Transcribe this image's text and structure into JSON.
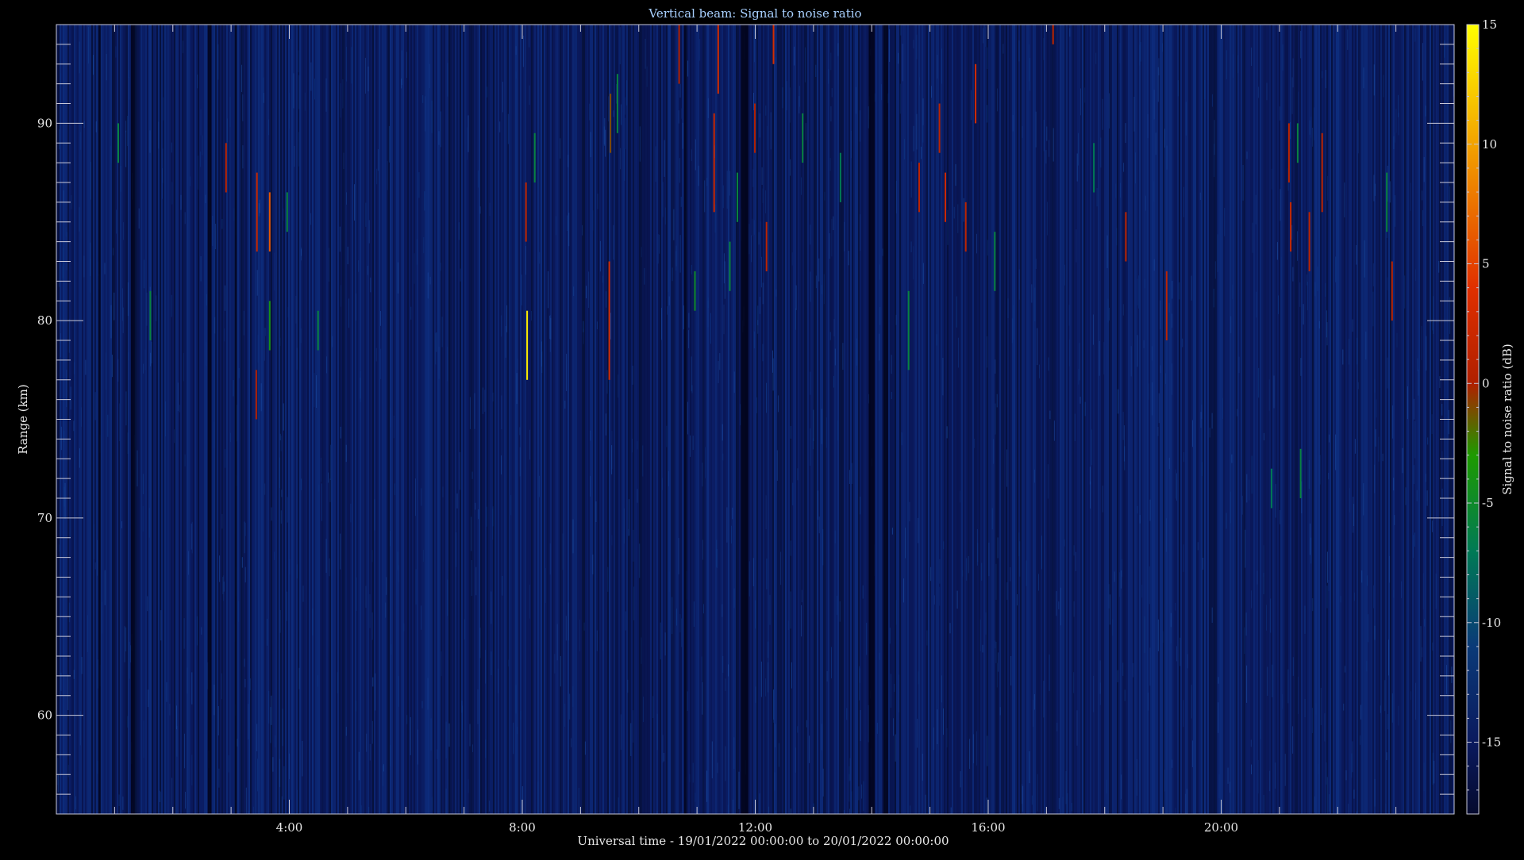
{
  "chart_data": {
    "type": "heatmap",
    "title": "Vertical beam: Signal to noise ratio",
    "xlabel": "Universal time - 19/01/2022 00:00:00 to 20/01/2022 00:00:00",
    "ylabel": "Range (km)",
    "x_unit": "hours UT",
    "xlim": [
      0,
      24
    ],
    "ylim": [
      55,
      95
    ],
    "x_ticks": [
      {
        "value": 4,
        "label": "4:00"
      },
      {
        "value": 8,
        "label": "8:00"
      },
      {
        "value": 12,
        "label": "12:00"
      },
      {
        "value": 16,
        "label": "16:00"
      },
      {
        "value": 20,
        "label": "20:00"
      }
    ],
    "x_minor_step": 1,
    "y_ticks": [
      {
        "value": 60,
        "label": "60"
      },
      {
        "value": 70,
        "label": "70"
      },
      {
        "value": 80,
        "label": "80"
      },
      {
        "value": 90,
        "label": "90"
      }
    ],
    "y_minor_step": 1,
    "colorbar": {
      "label": "Signal to noise ratio (dB)",
      "range": [
        -18,
        15
      ],
      "ticks": [
        {
          "value": 15,
          "label": "15"
        },
        {
          "value": 10,
          "label": "10"
        },
        {
          "value": 5,
          "label": "5"
        },
        {
          "value": 0,
          "label": "0"
        },
        {
          "value": -5,
          "label": "-5"
        },
        {
          "value": -10,
          "label": "-10"
        },
        {
          "value": -15,
          "label": "-15"
        }
      ],
      "minor_step": 1,
      "colormap": [
        {
          "value": -18,
          "color": "#050a2e"
        },
        {
          "value": -15,
          "color": "#0a1a5e"
        },
        {
          "value": -11,
          "color": "#0a3a78"
        },
        {
          "value": -7,
          "color": "#007a55"
        },
        {
          "value": -3,
          "color": "#1e9a00"
        },
        {
          "value": 0,
          "color": "#b02000"
        },
        {
          "value": 4,
          "color": "#e03000"
        },
        {
          "value": 9,
          "color": "#f09000"
        },
        {
          "value": 15,
          "color": "#ffff00"
        }
      ]
    },
    "background_level_db": -15,
    "data_gaps_hours": [
      [
        1.28,
        1.36
      ],
      [
        2.6,
        2.66
      ],
      [
        3.06,
        3.1
      ],
      [
        11.75,
        11.88
      ],
      [
        10.78,
        10.82
      ],
      [
        13.95,
        14.05
      ],
      [
        14.2,
        14.28
      ],
      [
        0.72,
        0.76
      ]
    ],
    "echoes": [
      {
        "time": 2.9,
        "range_top": 89.0,
        "range_bottom": 86.5,
        "snr": 1
      },
      {
        "time": 3.43,
        "range_top": 87.5,
        "range_bottom": 83.5,
        "snr": 2
      },
      {
        "time": 3.42,
        "range_top": 77.5,
        "range_bottom": 75.0,
        "snr": 0
      },
      {
        "time": 3.65,
        "range_top": 86.5,
        "range_bottom": 83.5,
        "snr": 6
      },
      {
        "time": 3.65,
        "range_top": 81.0,
        "range_bottom": 78.5,
        "snr": -4
      },
      {
        "time": 3.95,
        "range_top": 86.5,
        "range_bottom": 84.5,
        "snr": -6
      },
      {
        "time": 4.48,
        "range_top": 80.5,
        "range_bottom": 78.5,
        "snr": -6
      },
      {
        "time": 1.6,
        "range_top": 81.5,
        "range_bottom": 79.0,
        "snr": -6
      },
      {
        "time": 1.05,
        "range_top": 90.0,
        "range_bottom": 88.0,
        "snr": -6
      },
      {
        "time": 8.05,
        "range_top": 87.0,
        "range_bottom": 84.0,
        "snr": 1
      },
      {
        "time": 8.07,
        "range_top": 80.5,
        "range_bottom": 77.0,
        "snr": 14
      },
      {
        "time": 9.48,
        "range_top": 83.0,
        "range_bottom": 77.0,
        "snr": 3
      },
      {
        "time": 9.5,
        "range_top": 91.5,
        "range_bottom": 88.5,
        "snr": -1
      },
      {
        "time": 9.62,
        "range_top": 92.5,
        "range_bottom": 89.5,
        "snr": -6
      },
      {
        "time": 8.2,
        "range_top": 89.5,
        "range_bottom": 87.0,
        "snr": -6
      },
      {
        "time": 10.68,
        "range_top": 95.0,
        "range_bottom": 92.0,
        "snr": 0
      },
      {
        "time": 11.28,
        "range_top": 90.5,
        "range_bottom": 85.5,
        "snr": 2
      },
      {
        "time": 11.35,
        "range_top": 95.0,
        "range_bottom": 91.5,
        "snr": 3
      },
      {
        "time": 11.55,
        "range_top": 84.0,
        "range_bottom": 81.5,
        "snr": -6
      },
      {
        "time": 11.68,
        "range_top": 87.5,
        "range_bottom": 85.0,
        "snr": -6
      },
      {
        "time": 11.98,
        "range_top": 91.0,
        "range_bottom": 88.5,
        "snr": 0
      },
      {
        "time": 12.3,
        "range_top": 95.0,
        "range_bottom": 93.0,
        "snr": 3
      },
      {
        "time": 12.18,
        "range_top": 85.0,
        "range_bottom": 82.5,
        "snr": 1
      },
      {
        "time": 12.8,
        "range_top": 90.5,
        "range_bottom": 88.0,
        "snr": -6
      },
      {
        "time": 10.95,
        "range_top": 82.5,
        "range_bottom": 80.5,
        "snr": -5
      },
      {
        "time": 14.8,
        "range_top": 88.0,
        "range_bottom": 85.5,
        "snr": 1
      },
      {
        "time": 14.62,
        "range_top": 81.5,
        "range_bottom": 77.5,
        "snr": -6
      },
      {
        "time": 15.15,
        "range_top": 91.0,
        "range_bottom": 88.5,
        "snr": 1
      },
      {
        "time": 15.25,
        "range_top": 87.5,
        "range_bottom": 85.0,
        "snr": 2
      },
      {
        "time": 15.6,
        "range_top": 86.0,
        "range_bottom": 83.5,
        "snr": 1
      },
      {
        "time": 15.77,
        "range_top": 93.0,
        "range_bottom": 90.0,
        "snr": 3
      },
      {
        "time": 16.1,
        "range_top": 84.5,
        "range_bottom": 81.5,
        "snr": -6
      },
      {
        "time": 17.1,
        "range_top": 95.0,
        "range_bottom": 94.0,
        "snr": 1
      },
      {
        "time": 18.35,
        "range_top": 85.5,
        "range_bottom": 83.0,
        "snr": 1
      },
      {
        "time": 19.05,
        "range_top": 82.5,
        "range_bottom": 79.0,
        "snr": 1
      },
      {
        "time": 21.15,
        "range_top": 90.0,
        "range_bottom": 87.0,
        "snr": 1
      },
      {
        "time": 21.18,
        "range_top": 86.0,
        "range_bottom": 83.5,
        "snr": 2
      },
      {
        "time": 21.3,
        "range_top": 90.0,
        "range_bottom": 88.0,
        "snr": -6
      },
      {
        "time": 21.5,
        "range_top": 85.5,
        "range_bottom": 82.5,
        "snr": 1
      },
      {
        "time": 21.72,
        "range_top": 89.5,
        "range_bottom": 85.5,
        "snr": 1
      },
      {
        "time": 22.83,
        "range_top": 87.5,
        "range_bottom": 84.5,
        "snr": -6
      },
      {
        "time": 22.92,
        "range_top": 83.0,
        "range_bottom": 80.0,
        "snr": 1
      },
      {
        "time": 21.35,
        "range_top": 73.5,
        "range_bottom": 71.0,
        "snr": -6
      },
      {
        "time": 20.85,
        "range_top": 72.5,
        "range_bottom": 70.5,
        "snr": -7
      },
      {
        "time": 17.8,
        "range_top": 89.0,
        "range_bottom": 86.5,
        "snr": -7
      },
      {
        "time": 13.45,
        "range_top": 88.5,
        "range_bottom": 86.0,
        "snr": -7
      }
    ]
  }
}
